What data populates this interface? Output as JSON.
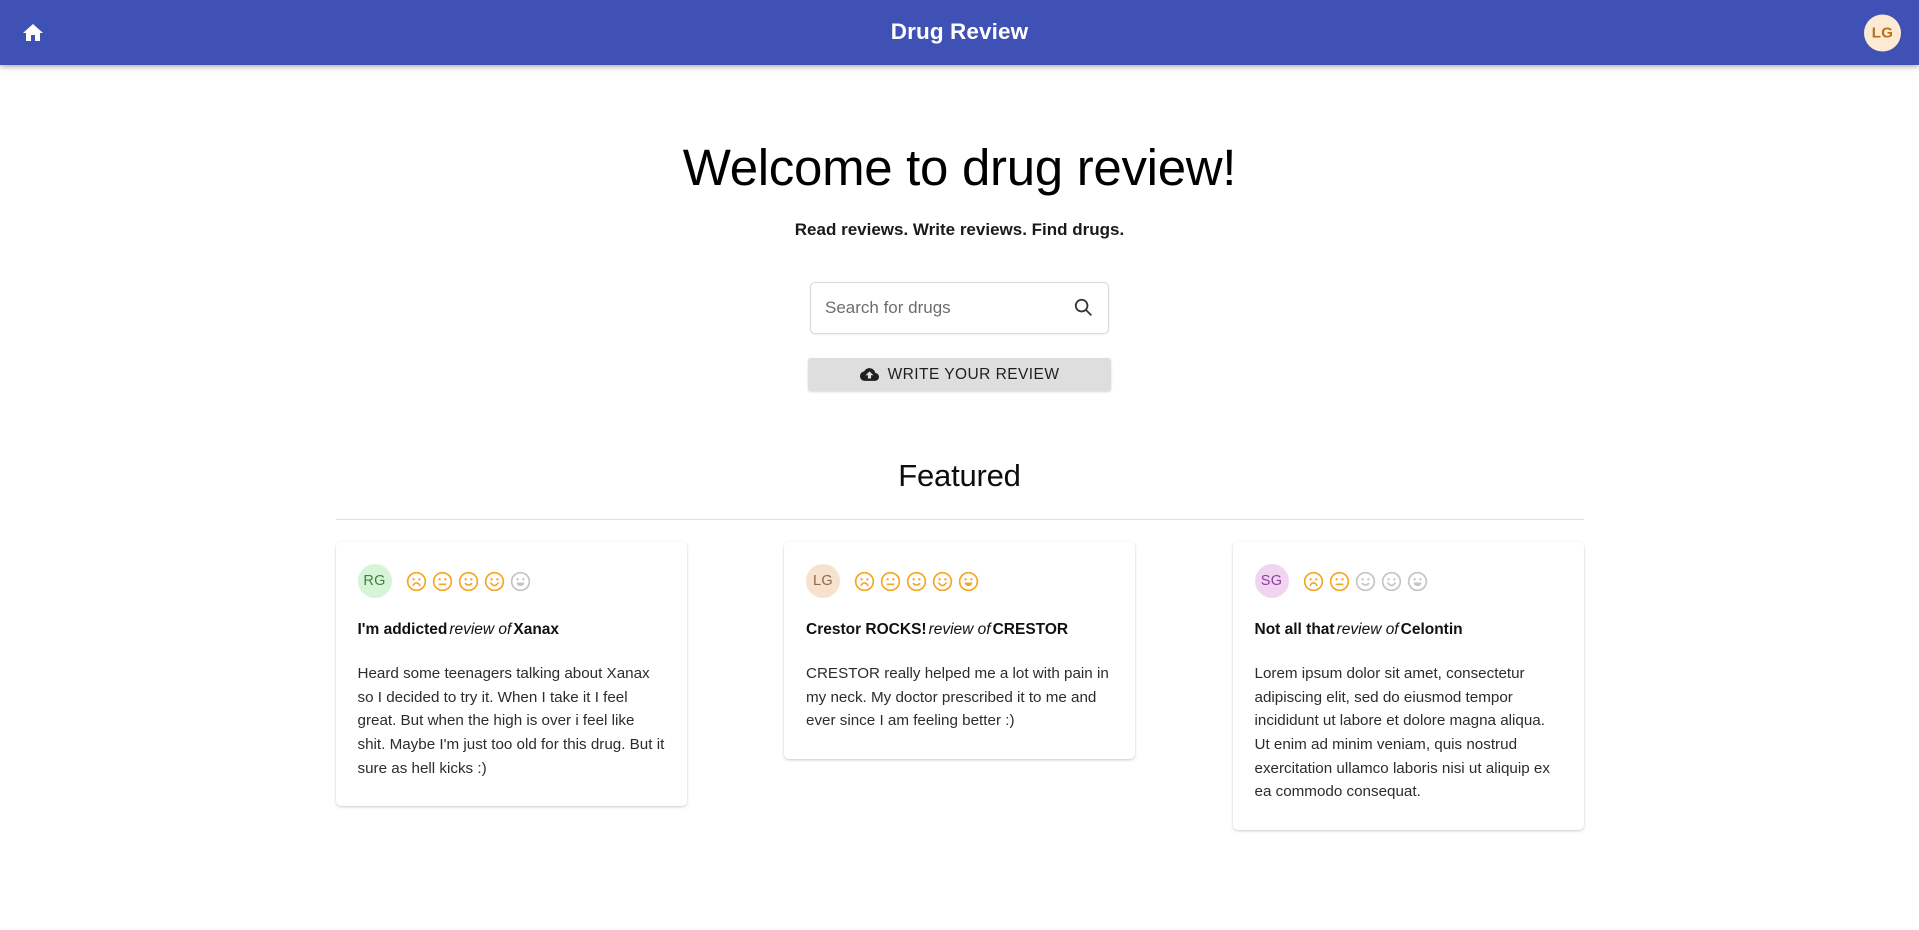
{
  "appbar": {
    "home_icon": "home-icon",
    "title": "Drug Review",
    "avatar_initials": "LG",
    "bg_color": "#3f51b5",
    "avatar_bg": "#fdead3",
    "avatar_fg": "#b3711a"
  },
  "hero": {
    "heading": "Welcome to drug review!",
    "tagline": "Read reviews. Write reviews. Find drugs."
  },
  "search": {
    "placeholder": "Search for drugs",
    "value": "",
    "icon": "search-icon"
  },
  "write_review_button": {
    "label": "WRITE YOUR REVIEW",
    "icon": "cloud-upload-icon",
    "bg_color": "#dedede"
  },
  "featured": {
    "heading": "Featured",
    "rating_active_color": "#f5a623",
    "rating_inactive_color": "#c4c4c4",
    "max_rating": 5,
    "cards": [
      {
        "avatar_initials": "RG",
        "avatar_bg": "#d6f5d6",
        "avatar_fg": "#4a7a4a",
        "rating": 4,
        "title": "I'm addicted",
        "title_middle": "review of",
        "drug": "Xanax",
        "body": "Heard some teenagers talking about Xanax so I decided to try it. When I take it I feel great. But when the high is over i feel like shit. Maybe I'm just too old for this drug. But it sure as hell kicks :)"
      },
      {
        "avatar_initials": "LG",
        "avatar_bg": "#f7e2cd",
        "avatar_fg": "#8a6a4d",
        "rating": 5,
        "title": "Crestor ROCKS!",
        "title_middle": "review of",
        "drug": "CRESTOR",
        "body": "CRESTOR really helped me a lot with pain in my neck. My doctor prescribed it to me and ever since I am feeling better :)"
      },
      {
        "avatar_initials": "SG",
        "avatar_bg": "#f0d4f0",
        "avatar_fg": "#8a3fa0",
        "rating": 2,
        "title": "Not all that",
        "title_middle": "review of",
        "drug": "Celontin",
        "body": "Lorem ipsum dolor sit amet, consectetur adipiscing elit, sed do eiusmod tempor incididunt ut labore et dolore magna aliqua. Ut enim ad minim veniam, quis nostrud exercitation ullamco laboris nisi ut aliquip ex ea commodo consequat."
      }
    ]
  }
}
